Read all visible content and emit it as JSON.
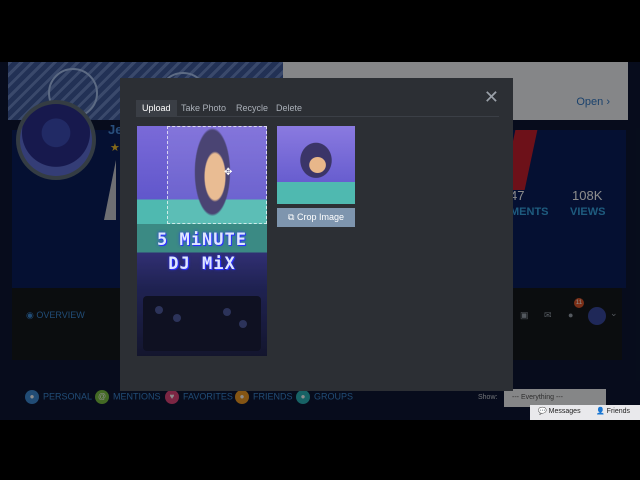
{
  "background": {
    "banner": {
      "open_label": "Open"
    },
    "profile": {
      "name_peek": "Je",
      "stats": [
        {
          "value": "47",
          "label": "MENTS"
        },
        {
          "value": "108K",
          "label": "VIEWS"
        }
      ]
    },
    "nav": {
      "overview": "OVERVIEW",
      "notification_count": "11"
    },
    "filters": [
      {
        "label": "PERSONAL",
        "color": "#3c8ad6"
      },
      {
        "label": "MENTIONS",
        "color": "#7ac142"
      },
      {
        "label": "FAVORITES",
        "color": "#e0457b"
      },
      {
        "label": "FRIENDS",
        "color": "#f09c26"
      },
      {
        "label": "GROUPS",
        "color": "#2ab3b8"
      }
    ],
    "show_label": "Show:",
    "show_value": "--- Everything ---",
    "chat": {
      "messages": "Messages",
      "friends": "Friends"
    }
  },
  "modal": {
    "tabs": [
      "Upload",
      "Take Photo",
      "Recycle",
      "Delete"
    ],
    "active_tab": "Upload",
    "image_text_line1": "5 MiNUTE",
    "image_text_line2": "DJ MiX",
    "crop_button": "Crop Image"
  },
  "colors": {
    "modal_bg": "#2c2f34",
    "crop_button": "#7e95ae",
    "link": "#3c8ad6"
  }
}
